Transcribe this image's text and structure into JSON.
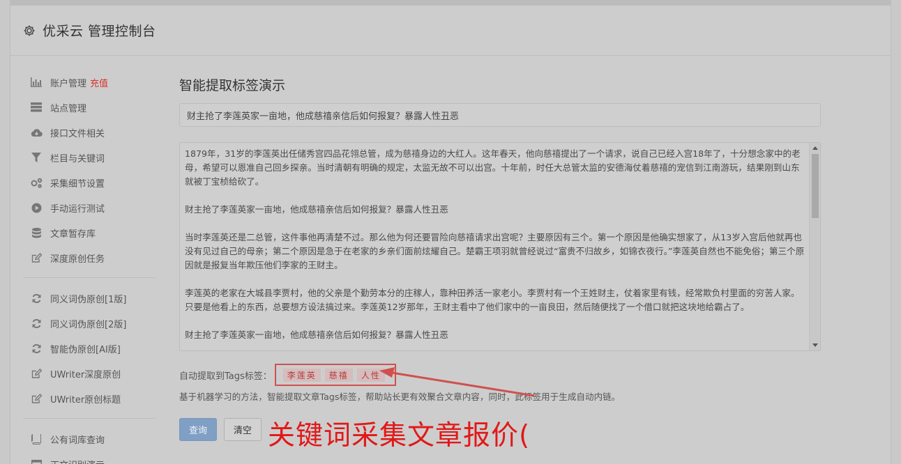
{
  "header": {
    "title": "优采云 管理控制台"
  },
  "sidebar": {
    "group1": [
      {
        "label": "账户管理",
        "badge": "充值",
        "icon": "bar-chart-icon"
      },
      {
        "label": "站点管理",
        "icon": "server-icon"
      },
      {
        "label": "接口文件相关",
        "icon": "cloud-download-icon"
      },
      {
        "label": "栏目与关键词",
        "icon": "filter-icon"
      },
      {
        "label": "采集细节设置",
        "icon": "gears-icon"
      },
      {
        "label": "手动运行测试",
        "icon": "play-circle-icon"
      },
      {
        "label": "文章暂存库",
        "icon": "database-icon"
      },
      {
        "label": "深度原创任务",
        "icon": "edit-icon"
      }
    ],
    "group2": [
      {
        "label": "同义词伪原创[1版]",
        "icon": "refresh-icon"
      },
      {
        "label": "同义词伪原创[2版]",
        "icon": "refresh-icon"
      },
      {
        "label": "智能伪原创[AI版]",
        "icon": "refresh-icon"
      },
      {
        "label": "UWriter深度原创",
        "icon": "edit-icon"
      },
      {
        "label": "UWriter原创标题",
        "icon": "edit-icon"
      }
    ],
    "group3": [
      {
        "label": "公有词库查询",
        "icon": "book-icon"
      },
      {
        "label": "正文识别演示",
        "icon": "window-icon"
      }
    ]
  },
  "main": {
    "heading": "智能提取标签演示",
    "title_value": "财主抢了李莲英家一亩地，他成慈禧亲信后如何报复？暴露人性丑恶",
    "content_paragraphs": [
      "1879年，31岁的李莲英出任储秀宫四品花翎总管，成为慈禧身边的大红人。这年春天，他向慈禧提出了一个请求，说自己已经入宫18年了，十分想念家中的老母，希望可以恩准自己回乡探亲。当时清朝有明确的规定，太监无故不可以出宫。十年前，时任大总管太监的安德海仗着慈禧的宠信到江南游玩，结果刚到山东就被丁宝桢给砍了。",
      "财主抢了李莲英家一亩地，他成慈禧亲信后如何报复？暴露人性丑恶",
      "当时李莲英还是二总管，这件事他再清楚不过。那么他为何还要冒险向慈禧请求出宫呢？主要原因有三个。第一个原因是他确实想家了，从13岁入宫后他就再也没有见过自己的母亲；第二个原因是急于在老家的乡亲们面前炫耀自己。楚霸王项羽就曾经说过“富贵不归故乡，如锦衣夜行。”李莲英自然也不能免俗；第三个原因就是报复当年欺压他们李家的王财主。",
      "李莲英的老家在大城县李贾村，他的父亲是个勤劳本分的庄稼人，靠种田养活一家老小。李贾村有一个王姓财主，仗着家里有钱，经常欺负村里面的穷苦人家。只要是他看上的东西，总要想方设法搞过来。李莲英12岁那年，王财主看中了他们家中的一亩良田，然后随便找了一个借口就把这块地给霸占了。",
      "财主抢了李莲英家一亩地，他成慈禧亲信后如何报复？暴露人性丑恶"
    ],
    "tags_label": "自动提取到Tags标签：",
    "tags": [
      "李莲英",
      "慈禧",
      "人性"
    ],
    "description": "基于机器学习的方法，智能提取文章Tags标签，帮助站长更有效聚合文章内容，同时，此标签用于生成自动内链。",
    "query_button": "查询",
    "clear_button": "清空"
  },
  "overlay": {
    "text": "关键词采集文章报价("
  },
  "colors": {
    "accent_red": "#e21818",
    "tag_border": "#d0504e",
    "primary_button": "#7f9fc5"
  }
}
